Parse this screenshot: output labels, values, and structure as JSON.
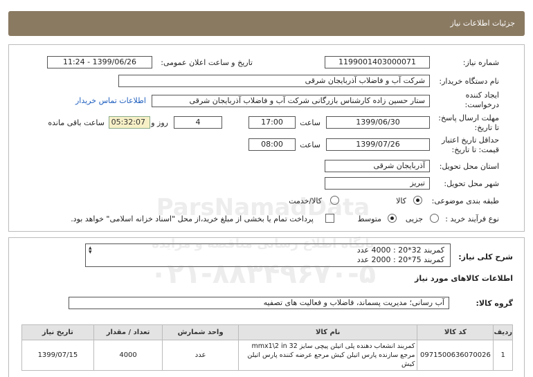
{
  "header": {
    "title": "جزئیات اطلاعات نیاز"
  },
  "form": {
    "need_number_label": "شماره نیاز:",
    "need_number": "1199001403000071",
    "announce_label": "تاریخ و ساعت اعلان عمومی:",
    "announce_value": "1399/06/26 - 11:24",
    "buyer_label": "نام دستگاه خریدار:",
    "buyer_value": "شرکت آب و فاضلاب آذربایجان شرقی",
    "creator_label_1": "ایجاد کننده",
    "creator_label_2": "درخواست:",
    "creator_value": "ستار حسین زاده کارشناس بازرگانی شرکت آب و فاضلاب آذربایجان شرقی",
    "contact_link": "اطلاعات تماس خریدار",
    "deadline_label_1": "مهلت ارسال پاسخ:",
    "deadline_label_2": "تا تاریخ:",
    "deadline_date": "1399/06/30",
    "time_label": "ساعت",
    "deadline_time": "17:00",
    "days_value": "4",
    "days_label": "روز و",
    "remaining_value": "05:32:07",
    "remaining_label": "ساعت باقی مانده",
    "validity_label_1": "حداقل تاریخ اعتبار",
    "validity_label_2": "قیمت: تا تاریخ:",
    "validity_date": "1399/07/26",
    "validity_time": "08:00",
    "province_label": "استان محل تحویل:",
    "province_value": "آذربایجان شرقی",
    "city_label": "شهر محل تحویل:",
    "city_value": "تبریز",
    "category_label": "طبقه بندی موضوعی:",
    "category_options": [
      "کالا",
      "کالا/خدمت"
    ],
    "purchase_label": "نوع فرآیند خرید :",
    "purchase_options": [
      "جزیی",
      "متوسط"
    ],
    "payment_note": "پرداخت تمام یا بخشی از مبلغ خرید،از محل \"اسناد خزانه اسلامی\" خواهد بود."
  },
  "summary": {
    "label": "شرح کلی نیاز:",
    "line1": "کمربند 32*20 : 4000 عدد",
    "line2": "کمربند 75*20 : 2000 عدد"
  },
  "goods": {
    "section_title": "اطلاعات کالاهای مورد نیاز",
    "group_label": "گروه کالا:",
    "group_value": "آب رسانی؛ مدیریت پسماند، فاضلاب و فعالیت های تصفیه",
    "columns": [
      "ردیف",
      "کد کالا",
      "نام کالا",
      "واحد شمارش",
      "تعداد / مقدار",
      "تاریخ نیاز"
    ],
    "rows": [
      {
        "row": "1",
        "code": "0971500636070026",
        "name": "کمربند انشعاب دهنده پلی اتیلن پیچی سایز mmx1\\2 in 32 مرجع سازنده پارس اتیلن کیش مرجع عرضه کننده پارس اتیلن کیش",
        "unit": "عدد",
        "qty": "4000",
        "date": "1399/07/15"
      }
    ]
  },
  "watermark": {
    "line1": "ParsNamadData",
    "line2": "پایگاه اطلاع رسانی مناقصه و مزایده",
    "line3": "۰۲۱-۸۸۳۴۹۶۷۰-۵"
  }
}
